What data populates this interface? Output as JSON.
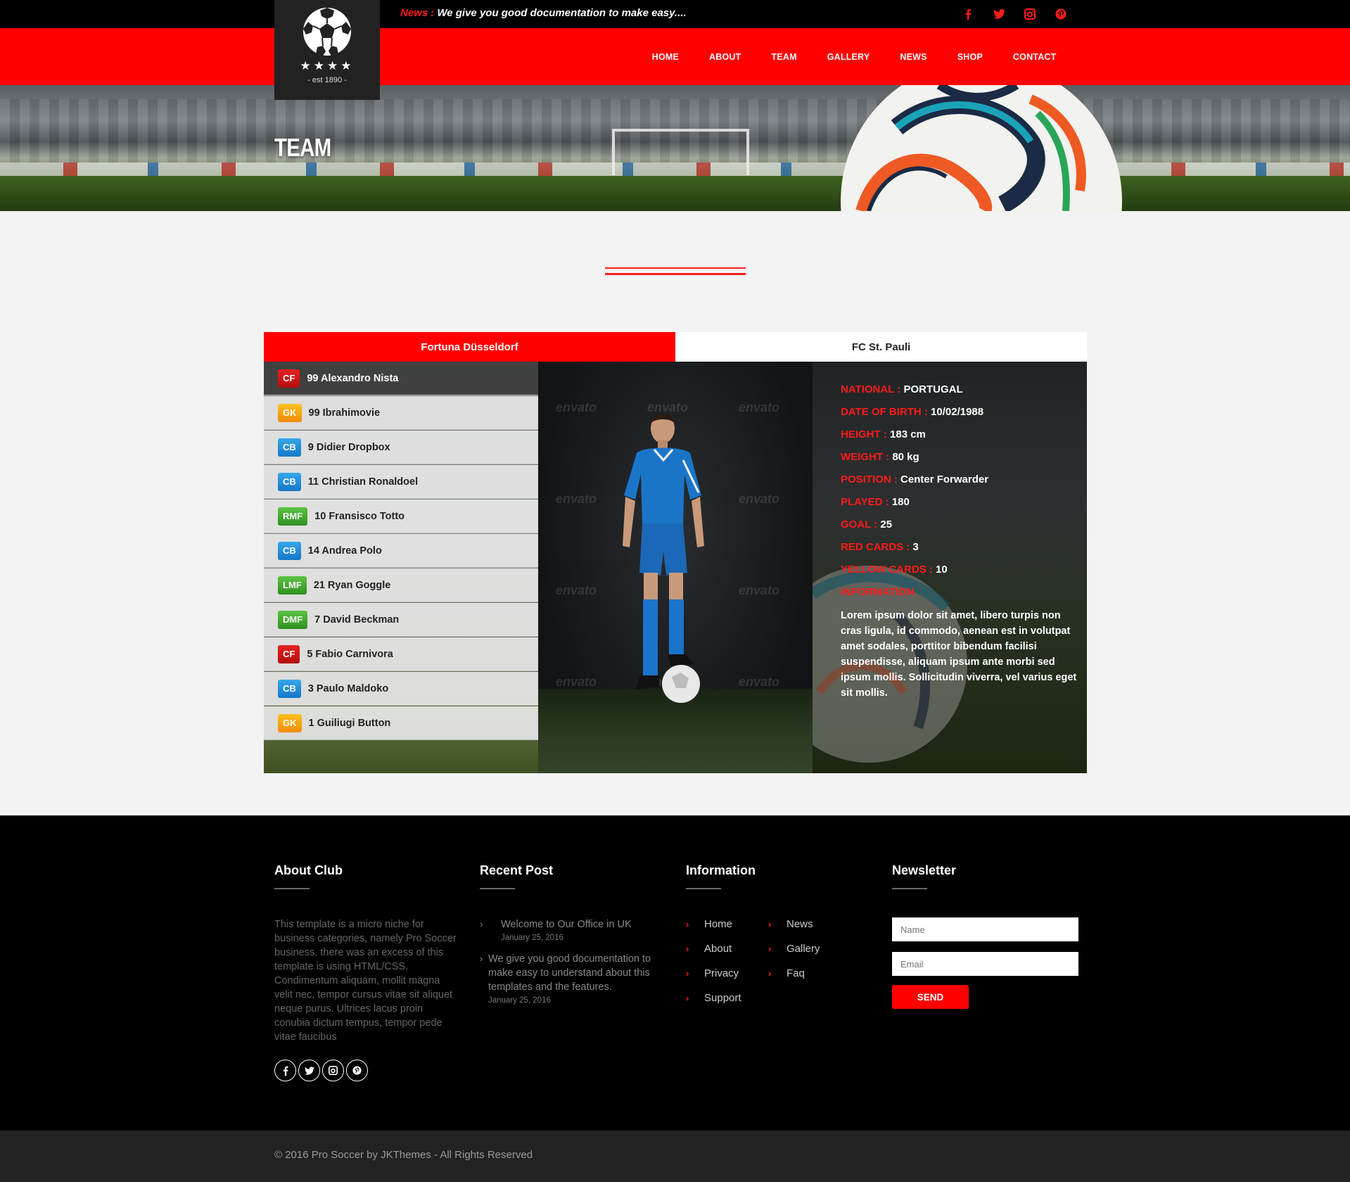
{
  "topbar": {
    "news_label": "News :",
    "news_text": "We give you good documentation to make easy....",
    "social": [
      "facebook-icon",
      "twitter-icon",
      "instagram-icon",
      "pinterest-icon"
    ]
  },
  "logo": {
    "stars": "★★★★",
    "est": "- est 1890 -"
  },
  "nav": {
    "items": [
      "HOME",
      "ABOUT",
      "TEAM",
      "GALLERY",
      "NEWS",
      "SHOP",
      "CONTACT"
    ]
  },
  "hero": {
    "title": "TEAM"
  },
  "tabs": [
    {
      "label": "Fortuna Düsseldorf",
      "active": true
    },
    {
      "label": "FC St. Pauli",
      "active": false
    }
  ],
  "players": [
    {
      "pos": "CF",
      "name": "99 Alexandro Nista",
      "color": "red",
      "active": true
    },
    {
      "pos": "GK",
      "name": "99 Ibrahimovie",
      "color": "orange"
    },
    {
      "pos": "CB",
      "name": "9 Didier Dropbox",
      "color": "blue"
    },
    {
      "pos": "CB",
      "name": "11 Christian Ronaldoel",
      "color": "blue"
    },
    {
      "pos": "RMF",
      "name": "10 Fransisco Totto",
      "color": "green"
    },
    {
      "pos": "CB",
      "name": "14 Andrea Polo",
      "color": "blue"
    },
    {
      "pos": "LMF",
      "name": "21 Ryan Goggle",
      "color": "green"
    },
    {
      "pos": "DMF",
      "name": "7 David Beckman",
      "color": "green"
    },
    {
      "pos": "CF",
      "name": "5 Fabio Carnivora",
      "color": "red"
    },
    {
      "pos": "CB",
      "name": "3 Paulo Maldoko",
      "color": "blue"
    },
    {
      "pos": "GK",
      "name": "1 Guiliugi Button",
      "color": "orange"
    }
  ],
  "photo": {
    "watermark": "envato"
  },
  "player_info": {
    "national_label": "NATIONAL :",
    "national": "PORTUGAL",
    "dob_label": "DATE OF BIRTH :",
    "dob": "10/02/1988",
    "height_label": "HEIGHT :",
    "height": "183 cm",
    "weight_label": "WEIGHT :",
    "weight": "80 kg",
    "position_label": "POSITION :",
    "position": "Center Forwarder",
    "played_label": "PLAYED :",
    "played": "180",
    "goal_label": "GOAL :",
    "goal": "25",
    "red_label": "RED CARDS :",
    "red": "3",
    "yellow_label": "YELLOW CARDS :",
    "yellow": "10",
    "info_label": "INFORMATION",
    "info_text": "Lorem ipsum dolor sit amet, libero turpis non cras ligula, id commodo, aenean est in volutpat amet sodales, porttitor bibendum facilisi suspendisse, aliquam ipsum ante morbi sed ipsum mollis. Sollicitudin viverra, vel varius eget sit mollis."
  },
  "footer": {
    "about_title": "About Club",
    "about_text": "This template is a micro niche for business categories, namely Pro Soccer business. there was an excess of this template is using HTML/CSS. Condimentum aliquam, mollit magna velit nec, tempor cursus vitae sit aliquet neque purus. Ultrices lacus proin conubia dictum tempus, tempor pede vitae faucibus",
    "recent_title": "Recent Post",
    "posts": [
      {
        "title": "Welcome to Our Office in UK",
        "date": "January 25, 2016"
      },
      {
        "title": "We give you good documentation to make easy to understand about this templates and the features.",
        "date": "January 25, 2016"
      }
    ],
    "info_title": "Information",
    "links": [
      "Home",
      "News",
      "About",
      "Gallery",
      "Privacy",
      "Faq",
      "Support"
    ],
    "newsletter_title": "Newsletter",
    "name_placeholder": "Name",
    "email_placeholder": "Email",
    "send_label": "SEND"
  },
  "copyright": "© 2016 Pro Soccer by JKThemes - All Rights Reserved",
  "colors": {
    "accent": "#ff0000",
    "dark": "#000000"
  }
}
